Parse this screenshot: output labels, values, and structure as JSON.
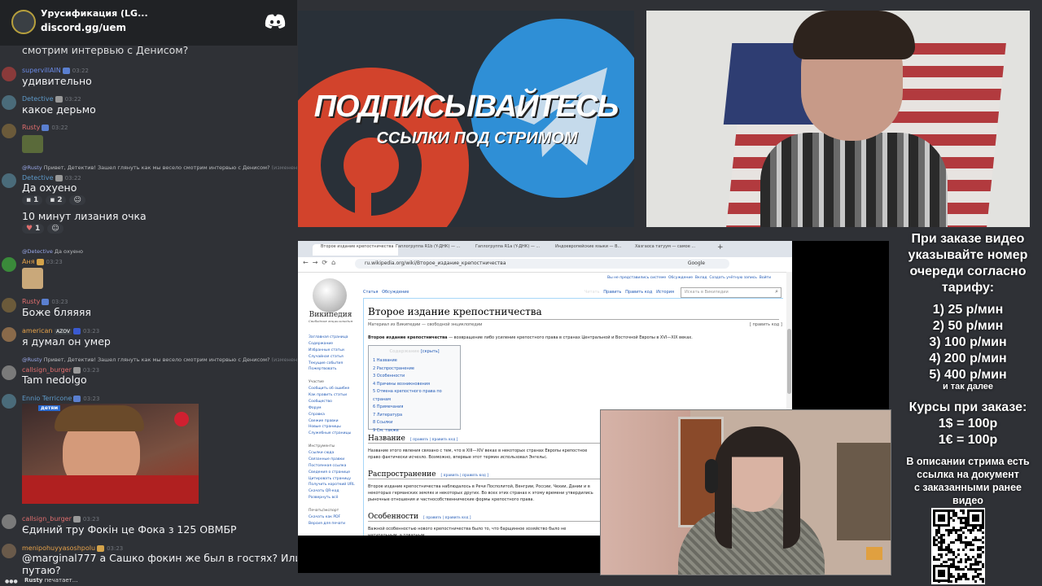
{
  "server": {
    "name": "Урусификация (LG...",
    "invite": "discord.gg/uem"
  },
  "chat": {
    "cutoff_text": "смотрим интервью с Денисом?",
    "messages": [
      {
        "user": "supervillAIN",
        "time": "03:22",
        "text": "удивительно",
        "color": "#6b8be8"
      },
      {
        "user": "Detective",
        "time": "03:22",
        "text": "какое дерьмо",
        "color": "#5d99c8"
      },
      {
        "user": "Rusty",
        "time": "03:22",
        "text": "",
        "color": "#e06e6e"
      },
      {
        "user": "Detective",
        "time": "03:22",
        "text": "Да охуено",
        "color": "#5d99c8",
        "reply": {
          "user": "@Rusty",
          "text": "Привет, Детектив! Зашел глянуть как мы весело смотрим интервью с Денисом?",
          "edited": "(изменено)"
        },
        "reactions": [
          "1",
          "2"
        ]
      },
      {
        "user": "",
        "time": "",
        "text": "10 минут лизания очка",
        "color": "#fff",
        "reactions": [
          "1"
        ]
      },
      {
        "user": "Аня",
        "time": "03:23",
        "text": "",
        "color": "#e6a24a",
        "reply": {
          "user": "@Detective",
          "text": "Да охуено"
        }
      },
      {
        "user": "Rusty",
        "time": "03:23",
        "text": "Боже бляяяя",
        "color": "#e06e6e"
      },
      {
        "user": "american",
        "badge": "AZOV",
        "time": "03:23",
        "text": "я думал он умер",
        "color": "#e6a24a"
      },
      {
        "user": "callsign_burger",
        "time": "03:23",
        "text": "Tam nedolgo",
        "color": "#e06e6e",
        "reply": {
          "user": "@Rusty",
          "text": "Привет, Детектив! Зашел глянуть как мы весело смотрим интервью с Денисом?",
          "edited": "(изменено)"
        }
      },
      {
        "user": "Ennio Terricone",
        "time": "03:23",
        "text": "",
        "color": "#5d99c8"
      },
      {
        "user": "callsign_burger",
        "time": "03:23",
        "text": "Єдиний тру Фокін це Фока з 125 ОВМБР",
        "color": "#e06e6e"
      },
      {
        "user": "menipohuyyasoshpolu",
        "time": "03:23",
        "text": "@marginal777 а Сашко фокин же был в гостях? Или я",
        "text2": "путаю?",
        "color": "#e6a24a"
      }
    ],
    "typing": {
      "user": "Rusty",
      "text": "печатает..."
    },
    "gif_caption": "детям"
  },
  "promo": {
    "line1": "ПОДПИСЫВАЙТЕСЬ",
    "line2": "ССЫЛКИ ПОД СТРИМОМ"
  },
  "browser": {
    "tabs": [
      "Второе издание крепостничества",
      "Гаплогруппа R1b (Y-ДНК) — ...",
      "Гаплогруппа R1a (Y-ДНК) — ...",
      "Индоевропейские языки — В...",
      "Ха́згаоса татуум — самое ..."
    ],
    "url": "ru.wikipedia.org/wiki/Второе_издание_крепостничества",
    "search_engine": "Google",
    "top_links": [
      "Вы не представились системе",
      "Обсуждение",
      "Вклад",
      "Создать учётную запись",
      "Войти"
    ],
    "wiki_name": "Википедия",
    "wiki_tagline": "Свободная энциклопедия",
    "page_tabs": [
      "Статья",
      "Обсуждение"
    ],
    "view_tabs": [
      "Читать",
      "Править",
      "Править код",
      "История"
    ],
    "search_placeholder": "Искать в Википедии",
    "title": "Второе издание крепостничества",
    "from_wiki": "Материал из Википедии — свободной энциклопедии",
    "edit_link": "[ править код ]",
    "lead_bold": "Второе издание крепостничества",
    "lead": " — возвращение либо усиление крепостного права в странах Центральной и Восточной Европы в XVI—XIX веках.",
    "toc_title": "Содержание",
    "toc_hide": "[скрыть]",
    "toc": [
      "1 Название",
      "2 Распространение",
      "3 Особенности",
      "4 Причины возникновения",
      "5 Отмена крепостного права по странам",
      "6 Примечания",
      "7 Литература",
      "8 Ссылки",
      "9 См. также"
    ],
    "sidebar": [
      "Заглавная страница",
      "Содержание",
      "Избранные статьи",
      "Случайная статья",
      "Текущие события",
      "Пожертвовать",
      "",
      "Участие",
      "Сообщить об ошибке",
      "Как править статьи",
      "Сообщество",
      "Форум",
      "Справка",
      "Свежие правки",
      "Новые страницы",
      "Служебные страницы",
      "",
      "Инструменты",
      "Ссылки сюда",
      "Связанные правки",
      "Постоянная ссылка",
      "Сведения о странице",
      "Цитировать страницу",
      "Получить короткий URL",
      "Скачать QR-код",
      "Развернуть всё",
      "",
      "Печать/экспорт",
      "Скачать как PDF",
      "Версия для печати"
    ],
    "sections": [
      {
        "h": "Название",
        "edit": "[ править | править код ]",
        "p": "Название этого явления связано с тем, что в XIII—XIV веках в некоторых странах Европы крепостное право фактически исчезло. Возможно, впервые этот термин использовал Энгельс."
      },
      {
        "h": "Распространение",
        "edit": "[ править | править код ]",
        "p": "Второе издание крепостничества наблюдалось в Речи Посполитой, Венгрии, России, Чехии, Дании и в некоторых германских землях и некоторых других. Во всех этих странах к этому времени утвердились рыночные отношения и частнособственнические формы крепостного права."
      },
      {
        "h": "Особенности",
        "edit": "[ править | править код ]",
        "p": "Важной особенностью нового крепостничества было то, что барщинное хозяйство было не натуральным, а товарным..."
      }
    ]
  },
  "info": {
    "title_lines": [
      "При заказе видео",
      "указывайте номер",
      "очереди согласно",
      "тарифу:"
    ],
    "prices": [
      "1) 25 р/мин",
      "2) 50 р/мин",
      "3) 100 р/мин",
      "4) 200 р/мин",
      "5) 400 р/мин"
    ],
    "more": "и так далее",
    "courses_title": "Курсы при заказе:",
    "courses": [
      "1$ = 100р",
      "1€ = 100р"
    ],
    "desc_lines": [
      "В описании стрима есть",
      "ссылка на документ",
      "с заказанными ранее",
      "видео"
    ]
  }
}
